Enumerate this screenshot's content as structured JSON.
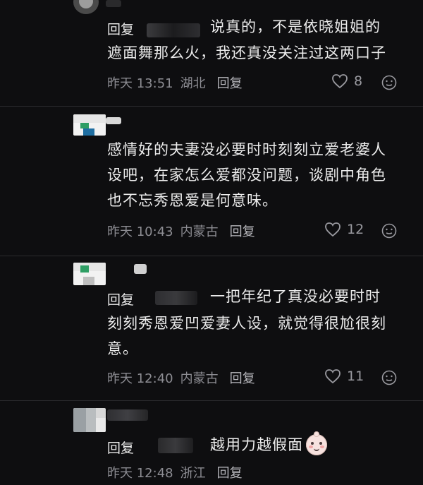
{
  "comments": [
    {
      "reply_prefix": "回复",
      "text_lines": [
        "说真的，不是依晓姐姐的",
        "遮面舞那么火，我还真没关注过这两口子"
      ],
      "time": "昨天 13:51",
      "location": "湖北",
      "reply_label": "回复",
      "likes": "8"
    },
    {
      "text_lines": [
        "感情好的夫妻没必要时时刻刻立爱老婆人",
        "设吧，在家怎么爱都没问题，谈剧中角色",
        "也不忘秀恩爱是何意味。"
      ],
      "time": "昨天 10:43",
      "location": "内蒙古",
      "reply_label": "回复",
      "likes": "12"
    },
    {
      "reply_prefix": "回复",
      "text_lines": [
        "一把年纪了真没必要时时",
        "刻刻秀恩爱凹爱妻人设，就觉得很尬很刻",
        "意。"
      ],
      "time": "昨天 12:40",
      "location": "内蒙古",
      "reply_label": "回复",
      "likes": "11"
    },
    {
      "reply_prefix": "回复",
      "text_lines": [
        "越用力越假面"
      ],
      "time": "昨天 12:48",
      "location": "浙江",
      "reply_label": "回复",
      "emoji": "smiling-face"
    }
  ],
  "colors": {
    "bg": "#0e0e10",
    "text": "#ececec",
    "meta": "#8c8c92"
  }
}
